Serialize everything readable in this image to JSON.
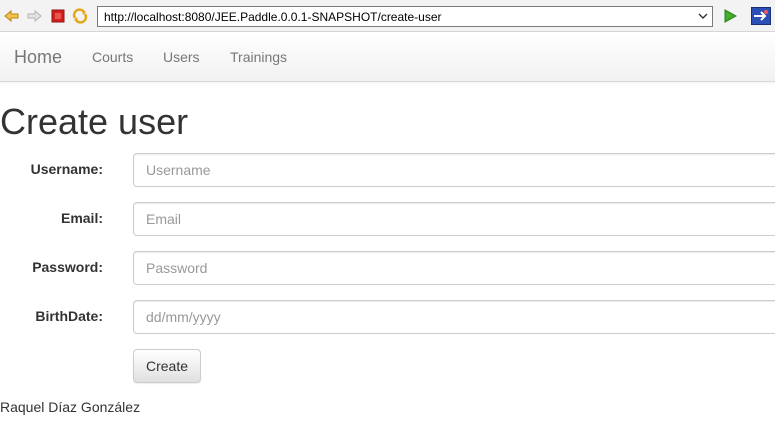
{
  "browser": {
    "url": "http://localhost:8080/JEE.Paddle.0.0.1-SNAPSHOT/create-user",
    "icons": [
      "back-arrow-icon",
      "forward-arrow-icon",
      "stop-icon",
      "refresh-icon",
      "address-dropdown-icon",
      "go-icon",
      "app-icon"
    ]
  },
  "navbar": {
    "brand": "Home",
    "links": [
      "Courts",
      "Users",
      "Trainings"
    ]
  },
  "page": {
    "title": "Create user"
  },
  "form": {
    "username": {
      "label": "Username:",
      "placeholder": "Username",
      "value": ""
    },
    "email": {
      "label": "Email:",
      "placeholder": "Email",
      "value": ""
    },
    "password": {
      "label": "Password:",
      "placeholder": "Password",
      "value": ""
    },
    "birthdate": {
      "label": "BirthDate:",
      "placeholder": "dd/mm/yyyy",
      "value": ""
    },
    "submit_label": "Create"
  },
  "footer": {
    "author": "Raquel Díaz González"
  },
  "colors": {
    "nav_text": "#777777",
    "title_text": "#333333",
    "placeholder": "#999999",
    "border": "#cccccc"
  }
}
